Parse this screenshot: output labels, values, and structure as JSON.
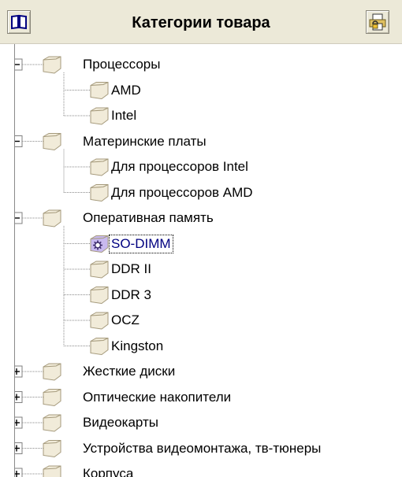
{
  "header": {
    "title": "Категории товара",
    "left_icon": "book-icon",
    "right_icon": "print-lock-icon"
  },
  "tree": {
    "nodes": [
      {
        "label": "Процессоры",
        "level": 0,
        "toggle": "minus",
        "icon": "folder-icon"
      },
      {
        "label": "AMD",
        "level": 1,
        "icon": "folder-icon"
      },
      {
        "label": "Intel",
        "level": 1,
        "icon": "folder-icon"
      },
      {
        "label": "Материнские платы",
        "level": 0,
        "toggle": "minus",
        "icon": "folder-icon"
      },
      {
        "label": "Для процессоров Intel",
        "level": 1,
        "icon": "folder-icon"
      },
      {
        "label": "Для процессоров AMD",
        "level": 1,
        "icon": "folder-icon"
      },
      {
        "label": "Оперативная память",
        "level": 0,
        "toggle": "minus",
        "icon": "folder-icon"
      },
      {
        "label": "SO-DIMM",
        "level": 1,
        "icon": "gear-folder-icon",
        "selected": true
      },
      {
        "label": "DDR II",
        "level": 1,
        "icon": "folder-icon"
      },
      {
        "label": "DDR 3",
        "level": 1,
        "icon": "folder-icon"
      },
      {
        "label": "OCZ",
        "level": 1,
        "icon": "folder-icon"
      },
      {
        "label": "Kingston",
        "level": 1,
        "icon": "folder-icon"
      },
      {
        "label": "Жесткие  диски",
        "level": 0,
        "toggle": "plus",
        "icon": "folder-icon"
      },
      {
        "label": "Оптические накопители",
        "level": 0,
        "toggle": "plus",
        "icon": "folder-icon"
      },
      {
        "label": "Видеокарты",
        "level": 0,
        "toggle": "plus",
        "icon": "folder-icon"
      },
      {
        "label": "Устройства видеомонтажа, тв-тюнеры",
        "level": 0,
        "toggle": "plus",
        "icon": "folder-icon"
      },
      {
        "label": "Корпуса",
        "level": 0,
        "toggle": "plus",
        "icon": "folder-icon"
      }
    ]
  },
  "colors": {
    "header_bg": "#ece9d8",
    "folder_fill": "#f1ebd9",
    "folder_edge": "#a59a7c",
    "selection_text": "#000080",
    "gear_folder_fill": "#c8b9ef"
  }
}
